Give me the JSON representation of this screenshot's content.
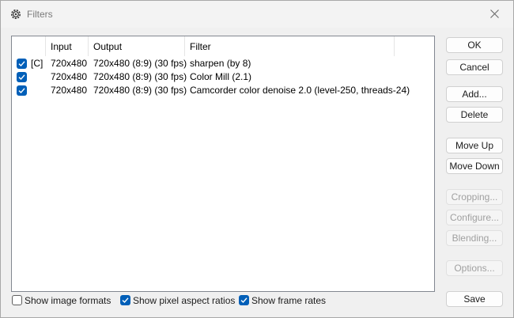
{
  "window": {
    "title": "Filters",
    "icon": "gear-app-icon",
    "close_icon": "close-icon"
  },
  "columns": [
    {
      "label": ""
    },
    {
      "label": "Input"
    },
    {
      "label": "Output"
    },
    {
      "label": "Filter"
    }
  ],
  "filters": [
    {
      "checked": true,
      "tag": "[C]",
      "input": "720x480",
      "output": "720x480 (8:9) (30 fps)",
      "filter": "sharpen (by 8)"
    },
    {
      "checked": true,
      "tag": "",
      "input": "720x480",
      "output": "720x480 (8:9) (30 fps)",
      "filter": "Color Mill (2.1)"
    },
    {
      "checked": true,
      "tag": "",
      "input": "720x480",
      "output": "720x480 (8:9) (30 fps)",
      "filter": "Camcorder color denoise 2.0 (level-250, threads-24)"
    }
  ],
  "buttons": {
    "ok": "OK",
    "cancel": "Cancel",
    "add": "Add...",
    "delete": "Delete",
    "move_up": "Move Up",
    "move_down": "Move Down",
    "cropping": "Cropping...",
    "configure": "Configure...",
    "blending": "Blending...",
    "options": "Options...",
    "save": "Save"
  },
  "options": {
    "image_formats": {
      "label": "Show image formats",
      "checked": false
    },
    "pixel_aspect": {
      "label": "Show pixel aspect ratios",
      "checked": true
    },
    "frame_rates": {
      "label": "Show frame rates",
      "checked": true
    }
  },
  "colors": {
    "accent": "#005fb8",
    "dialog_bg": "#f0f0f0",
    "disabled_text": "#a0a0a0"
  }
}
